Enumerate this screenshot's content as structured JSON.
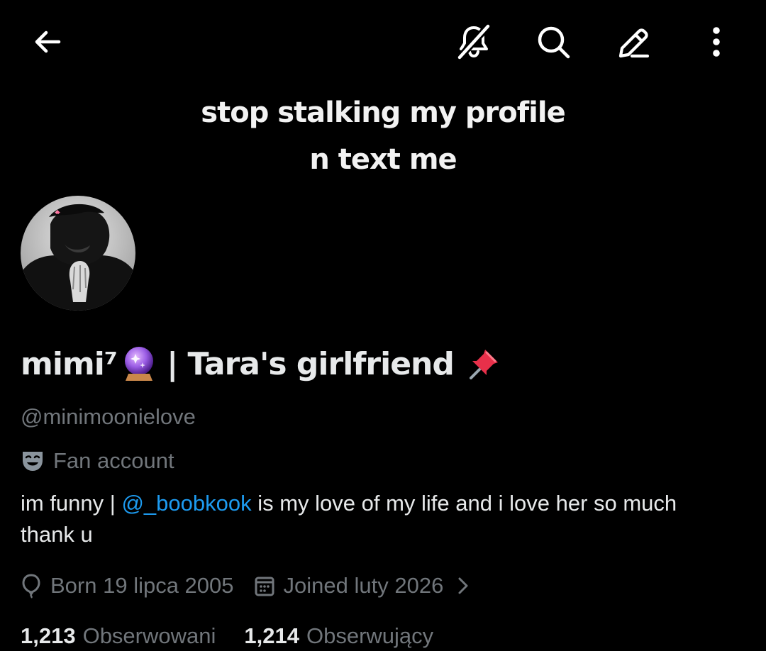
{
  "header": {
    "back_icon": "arrow-left-icon",
    "mute_icon": "mute-notifications-icon",
    "search_icon": "search-icon",
    "edit_icon": "edit-pen-icon",
    "more_icon": "more-vertical-icon"
  },
  "banner": {
    "line1": "stop stalking my profile",
    "line2": "n text me"
  },
  "avatar": {
    "icon": "profile-avatar"
  },
  "profile": {
    "name_main": "mimi⁷",
    "name_emoji_1": "crystal-ball-icon",
    "name_tail": "| Tara's girlfriend",
    "name_emoji_2": "pushpin-icon",
    "handle": "@minimoonielove",
    "category_icon": "performing-arts-mask-icon",
    "category": "Fan account",
    "bio": {
      "before": "im funny | ",
      "mention": "@_boobkook",
      "after": " is my love of my life and i love her so much thank u"
    },
    "born_icon": "balloon-icon",
    "born": "Born 19 lipca 2005",
    "joined_icon": "calendar-icon",
    "joined": "Joined luty 2026",
    "joined_chevron_icon": "chevron-right-icon"
  },
  "stats": {
    "following_count": "1,213",
    "following_label": "Obserwowani",
    "followers_count": "1,214",
    "followers_label": "Obserwujący"
  },
  "colors": {
    "background": "#000000",
    "text": "#e7e9ea",
    "secondary_text": "#71767b",
    "link": "#1d9bf0"
  }
}
